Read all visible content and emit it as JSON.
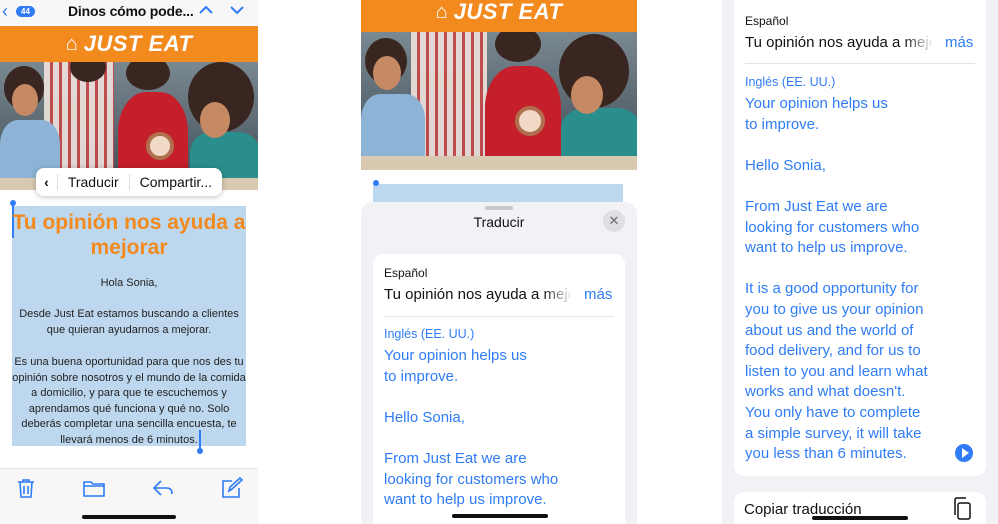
{
  "panel1": {
    "back_count": "44",
    "subject": "Dinos cómo pode...",
    "brand": "JUST EAT",
    "context_menu": {
      "translate": "Traducir",
      "share": "Compartir..."
    },
    "email": {
      "title": "Tu opinión nos ayuda a mejorar",
      "greeting": "Hola Sonia,",
      "para1": "Desde Just Eat estamos buscando a clientes que quieran ayudarnos a mejorar.",
      "para2": "Es una buena oportunidad para que nos des tu opinión sobre nosotros y el mundo de la comida a domicilio, y para que te escuchemos y aprendamos qué funciona y qué no. Solo deberás completar una sencilla encuesta, te llevará menos de 6 minutos."
    },
    "toolbar": [
      "trash-icon",
      "folder-icon",
      "reply-icon",
      "compose-icon"
    ]
  },
  "panel2": {
    "brand": "JUST EAT",
    "sheet_title": "Traducir",
    "source_language": "Español",
    "source_text": "Tu opinión nos ayuda a mejorar",
    "more": "más",
    "target_language": "Inglés (EE. UU.)",
    "target_text": "Your opinion helps us\nto improve.\n\nHello Sonia,\n\nFrom Just Eat we are\nlooking for customers who\nwant to help us improve."
  },
  "panel3": {
    "source_language": "Español",
    "source_text": "Tu opinión nos ayuda a mejorar",
    "more": "más",
    "target_language": "Inglés (EE. UU.)",
    "target_text": "Your opinion helps us\nto improve.\n\nHello Sonia,\n\nFrom Just Eat we are\nlooking for customers who\nwant to help us improve.\n\nIt is a good opportunity for\nyou to give us your opinion\nabout us and the world of\nfood delivery, and for us to\nlisten to you and learn what\nworks and what doesn't.\nYou only have to complete\na simple survey, it will take\nyou less than 6 minutes.",
    "copy_label": "Copiar traducción"
  },
  "colors": {
    "accent": "#2f7cf6",
    "brand": "#f28a1e",
    "selection": "#bdd7ee"
  }
}
